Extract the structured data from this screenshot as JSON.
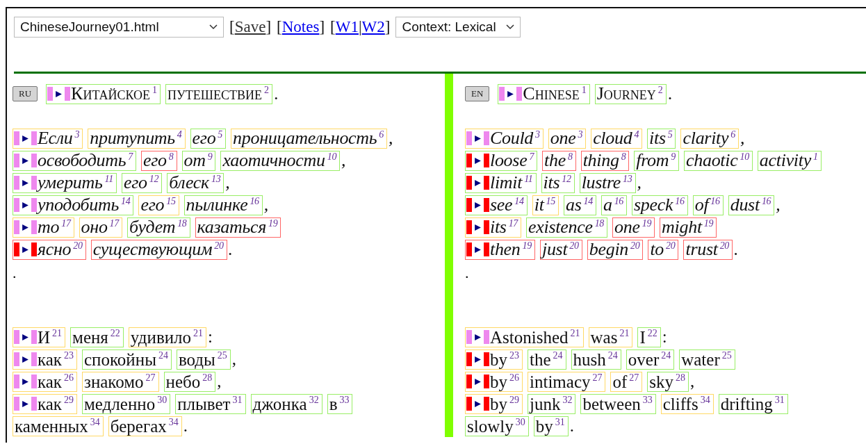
{
  "toolbar": {
    "file_select": {
      "value": "ChineseJourney01.html"
    },
    "link_groups": [
      {
        "open": "[",
        "close": "]",
        "links": [
          {
            "text": "Save",
            "kind": "action"
          }
        ]
      },
      {
        "open": "[",
        "close": "]",
        "links": [
          {
            "text": "Notes",
            "kind": "link"
          }
        ]
      },
      {
        "open": "[",
        "close": "]",
        "separator": "|",
        "links": [
          {
            "text": "W1",
            "kind": "link"
          },
          {
            "text": "W2",
            "kind": "link"
          }
        ]
      }
    ],
    "context_select": {
      "value": "Context: Lexical"
    }
  },
  "panes": [
    {
      "language": "RU",
      "paragraphs": [
        {
          "kind": "title",
          "lines": [
            {
              "marker": {
                "color": "#ee88ee"
              },
              "trail": ".",
              "words": [
                {
                  "text": "Китайское",
                  "index": "1",
                  "color": "#99ee66"
                },
                {
                  "text": "путешествие",
                  "index": "2",
                  "color": "#99ee66"
                }
              ]
            }
          ]
        },
        {
          "kind": "italic",
          "lines": [
            {
              "marker": {
                "color": "#ee88ee"
              },
              "trail": ",",
              "words": [
                {
                  "text": "Если",
                  "index": "3",
                  "color": "#ffd966"
                },
                {
                  "text": "притупить",
                  "index": "4",
                  "color": "#ffd966"
                },
                {
                  "text": "его",
                  "index": "5",
                  "color": "#99ee66"
                },
                {
                  "text": "проницательность",
                  "index": "6",
                  "color": "#ffd966"
                }
              ]
            },
            {
              "marker": {
                "color": "#ee88ee"
              },
              "trail": ",",
              "words": [
                {
                  "text": "освободить",
                  "index": "7",
                  "color": "#99ee66"
                },
                {
                  "text": "его",
                  "index": "8",
                  "color": "#ff6666"
                },
                {
                  "text": "от",
                  "index": "9",
                  "color": "#99ee66"
                },
                {
                  "text": "хаотичности",
                  "index": "10",
                  "color": "#99ee66"
                }
              ]
            },
            {
              "marker": {
                "color": "#ee88ee"
              },
              "trail": ",",
              "words": [
                {
                  "text": "умерить",
                  "index": "11",
                  "color": "#99ee66"
                },
                {
                  "text": "его",
                  "index": "12",
                  "color": "#99ee66"
                },
                {
                  "text": "блеск",
                  "index": "13",
                  "color": "#99ee66"
                }
              ]
            },
            {
              "marker": {
                "color": "#ee88ee"
              },
              "trail": ",",
              "words": [
                {
                  "text": "уподобить",
                  "index": "14",
                  "color": "#99ee66"
                },
                {
                  "text": "его",
                  "index": "15",
                  "color": "#ffd966"
                },
                {
                  "text": "пылинке",
                  "index": "16",
                  "color": "#99ee66"
                }
              ]
            },
            {
              "marker": {
                "color": "#ee88ee"
              },
              "words": [
                {
                  "text": "то",
                  "index": "17",
                  "color": "#ffd966"
                },
                {
                  "text": "оно",
                  "index": "17",
                  "color": "#ffd966"
                },
                {
                  "text": "будет",
                  "index": "18",
                  "color": "#99ee66"
                },
                {
                  "text": "казаться",
                  "index": "19",
                  "color": "#ff6666"
                }
              ]
            },
            {
              "marker": {
                "color": "#ff0000"
              },
              "trail": ".",
              "words": [
                {
                  "text": "ясно",
                  "index": "20",
                  "color": "#ff6666"
                },
                {
                  "text": "существующим",
                  "index": "20",
                  "color": "#ff6666"
                }
              ]
            }
          ]
        },
        {
          "kind": "note",
          "text": "."
        },
        {
          "kind": "plain",
          "lines": [
            {
              "marker": {
                "color": "#ee88ee"
              },
              "trail": ":",
              "words": [
                {
                  "text": "И",
                  "index": "21",
                  "color": "#ffd966"
                },
                {
                  "text": "меня",
                  "index": "22",
                  "color": "#99ee66"
                },
                {
                  "text": "удивило",
                  "index": "21",
                  "color": "#ffd966"
                }
              ]
            },
            {
              "marker": {
                "color": "#ee88ee"
              },
              "trail": ",",
              "words": [
                {
                  "text": "как",
                  "index": "23",
                  "color": "#ffd966"
                },
                {
                  "text": "спокойны",
                  "index": "24",
                  "color": "#99ee66"
                },
                {
                  "text": "воды",
                  "index": "25",
                  "color": "#99ee66"
                }
              ]
            },
            {
              "marker": {
                "color": "#ee88ee"
              },
              "trail": ",",
              "words": [
                {
                  "text": "как",
                  "index": "26",
                  "color": "#ffd966"
                },
                {
                  "text": "знакомо",
                  "index": "27",
                  "color": "#ffd966"
                },
                {
                  "text": "небо",
                  "index": "28",
                  "color": "#99ee66"
                }
              ]
            },
            {
              "marker": {
                "color": "#ee88ee"
              },
              "words": [
                {
                  "text": "как",
                  "index": "29",
                  "color": "#ffd966"
                },
                {
                  "text": "медленно",
                  "index": "30",
                  "color": "#99ee66"
                },
                {
                  "text": "плывет",
                  "index": "31",
                  "color": "#99ee66"
                },
                {
                  "text": "джонка",
                  "index": "32",
                  "color": "#99ee66"
                },
                {
                  "text": "в",
                  "index": "33",
                  "color": "#99ee66"
                }
              ]
            },
            {
              "trail": ".",
              "words": [
                {
                  "text": "каменных",
                  "index": "34",
                  "color": "#ffd966"
                },
                {
                  "text": "берегах",
                  "index": "34",
                  "color": "#ffd966"
                }
              ]
            }
          ]
        }
      ]
    },
    {
      "language": "EN",
      "paragraphs": [
        {
          "kind": "title",
          "lines": [
            {
              "marker": {
                "color": "#ee88ee"
              },
              "trail": ".",
              "words": [
                {
                  "text": "Chinese",
                  "index": "1",
                  "color": "#99ee66"
                },
                {
                  "text": "Journey",
                  "index": "2",
                  "color": "#99ee66"
                }
              ]
            }
          ]
        },
        {
          "kind": "italic",
          "lines": [
            {
              "marker": {
                "color": "#ee88ee"
              },
              "trail": ",",
              "words": [
                {
                  "text": "Could",
                  "index": "3",
                  "color": "#ffd966"
                },
                {
                  "text": "one",
                  "index": "3",
                  "color": "#ffd966"
                },
                {
                  "text": "cloud",
                  "index": "4",
                  "color": "#ffd966"
                },
                {
                  "text": "its",
                  "index": "5",
                  "color": "#99ee66"
                },
                {
                  "text": "clarity",
                  "index": "6",
                  "color": "#ffd966"
                }
              ]
            },
            {
              "marker": {
                "color": "#ff0000"
              },
              "words": [
                {
                  "text": "loose",
                  "index": "7",
                  "color": "#99ee66"
                },
                {
                  "text": "the",
                  "index": "8",
                  "color": "#ff6666"
                },
                {
                  "text": "thing",
                  "index": "8",
                  "color": "#ff6666"
                },
                {
                  "text": "from",
                  "index": "9",
                  "color": "#99ee66"
                },
                {
                  "text": "chaotic",
                  "index": "10",
                  "color": "#99ee66"
                },
                {
                  "text": "activity",
                  "index": "1",
                  "color": "#99ee66"
                }
              ]
            },
            {
              "marker": {
                "color": "#ff0000"
              },
              "trail": ",",
              "words": [
                {
                  "text": "limit",
                  "index": "11",
                  "color": "#99ee66"
                },
                {
                  "text": "its",
                  "index": "12",
                  "color": "#99ee66"
                },
                {
                  "text": "lustre",
                  "index": "13",
                  "color": "#99ee66"
                }
              ]
            },
            {
              "marker": {
                "color": "#ff0000"
              },
              "trail": ",",
              "words": [
                {
                  "text": "see",
                  "index": "14",
                  "color": "#99ee66"
                },
                {
                  "text": "it",
                  "index": "15",
                  "color": "#ffd966"
                },
                {
                  "text": "as",
                  "index": "14",
                  "color": "#99ee66"
                },
                {
                  "text": "a",
                  "index": "16",
                  "color": "#99ee66"
                },
                {
                  "text": "speck",
                  "index": "16",
                  "color": "#99ee66"
                },
                {
                  "text": "of",
                  "index": "16",
                  "color": "#99ee66"
                },
                {
                  "text": "dust",
                  "index": "16",
                  "color": "#99ee66"
                }
              ]
            },
            {
              "marker": {
                "color": "#ff0000"
              },
              "words": [
                {
                  "text": "its",
                  "index": "17",
                  "color": "#ffd966"
                },
                {
                  "text": "existence",
                  "index": "18",
                  "color": "#99ee66"
                },
                {
                  "text": "one",
                  "index": "19",
                  "color": "#ff6666"
                },
                {
                  "text": "might",
                  "index": "19",
                  "color": "#ff6666"
                }
              ]
            },
            {
              "marker": {
                "color": "#ff0000"
              },
              "trail": ".",
              "words": [
                {
                  "text": "then",
                  "index": "19",
                  "color": "#ff6666"
                },
                {
                  "text": "just",
                  "index": "20",
                  "color": "#ff6666"
                },
                {
                  "text": "begin",
                  "index": "20",
                  "color": "#ff6666"
                },
                {
                  "text": "to",
                  "index": "20",
                  "color": "#ff6666"
                },
                {
                  "text": "trust",
                  "index": "20",
                  "color": "#ff6666"
                }
              ]
            }
          ]
        },
        {
          "kind": "note",
          "text": "."
        },
        {
          "kind": "plain",
          "lines": [
            {
              "marker": {
                "color": "#ee88ee"
              },
              "trail": ":",
              "words": [
                {
                  "text": "Astonished",
                  "index": "21",
                  "color": "#ffd966"
                },
                {
                  "text": "was",
                  "index": "21",
                  "color": "#ffd966"
                },
                {
                  "text": "I",
                  "index": "22",
                  "color": "#99ee66"
                }
              ]
            },
            {
              "marker": {
                "color": "#ff0000"
              },
              "words": [
                {
                  "text": "by",
                  "index": "23",
                  "color": "#ffd966"
                },
                {
                  "text": "the",
                  "index": "24",
                  "color": "#99ee66"
                },
                {
                  "text": "hush",
                  "index": "24",
                  "color": "#99ee66"
                },
                {
                  "text": "over",
                  "index": "24",
                  "color": "#99ee66"
                },
                {
                  "text": "water",
                  "index": "25",
                  "color": "#99ee66"
                }
              ]
            },
            {
              "marker": {
                "color": "#ff0000"
              },
              "trail": ",",
              "words": [
                {
                  "text": "by",
                  "index": "26",
                  "color": "#ffd966"
                },
                {
                  "text": "intimacy",
                  "index": "27",
                  "color": "#ffd966"
                },
                {
                  "text": "of",
                  "index": "27",
                  "color": "#ffd966"
                },
                {
                  "text": "sky",
                  "index": "28",
                  "color": "#99ee66"
                }
              ]
            },
            {
              "marker": {
                "color": "#ff0000"
              },
              "words": [
                {
                  "text": "by",
                  "index": "29",
                  "color": "#ffd966"
                },
                {
                  "text": "junk",
                  "index": "32",
                  "color": "#99ee66"
                },
                {
                  "text": "between",
                  "index": "33",
                  "color": "#99ee66"
                },
                {
                  "text": "cliffs",
                  "index": "34",
                  "color": "#ffd966"
                },
                {
                  "text": "drifting",
                  "index": "31",
                  "color": "#99ee66"
                }
              ]
            },
            {
              "trail": ".",
              "words": [
                {
                  "text": "slowly",
                  "index": "30",
                  "color": "#99ee66"
                },
                {
                  "text": "by",
                  "index": "31",
                  "color": "#99ee66"
                }
              ]
            }
          ]
        }
      ]
    }
  ]
}
